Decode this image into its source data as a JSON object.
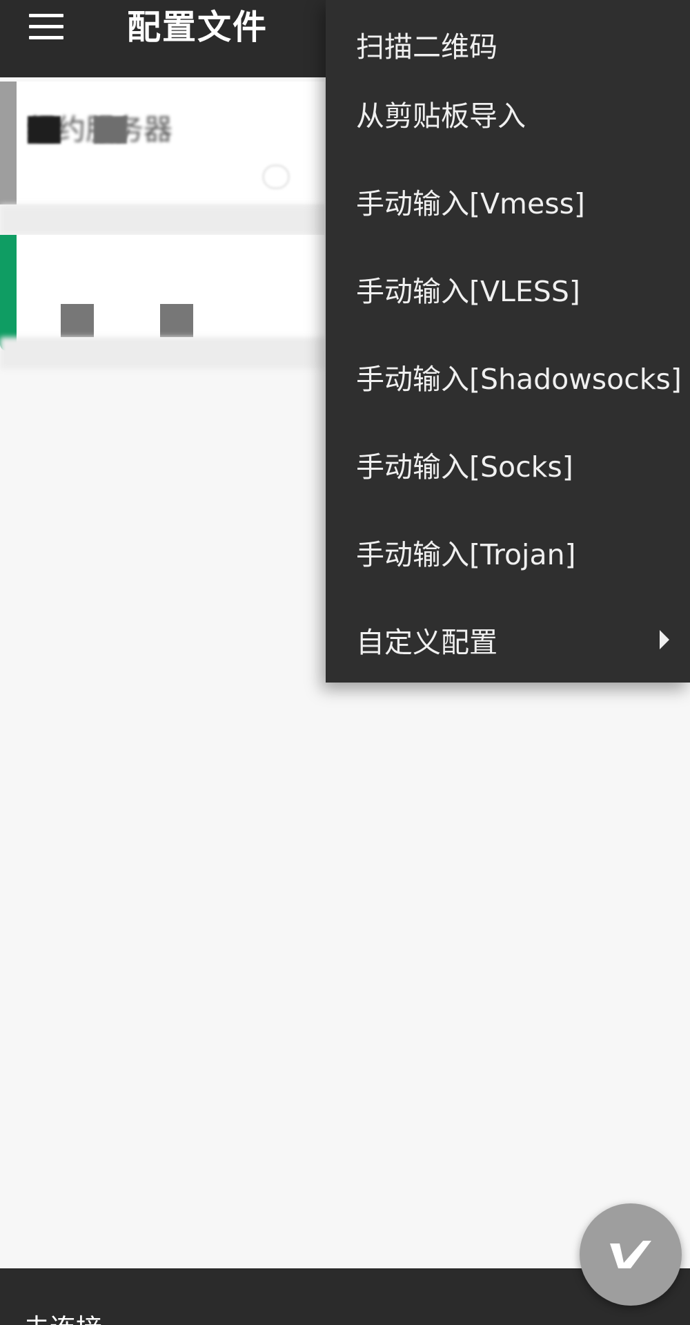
{
  "app_bar": {
    "title": "配置文件",
    "menu_icon": "hamburger-menu-icon"
  },
  "profile_list": {
    "items": [
      {
        "name": "纽约服务器",
        "stripe_color": "#9e9e9e"
      },
      {
        "name": "",
        "stripe_color": "#0f9d63"
      }
    ]
  },
  "overflow_menu": {
    "items": [
      {
        "label": "扫描二维码",
        "has_submenu": false
      },
      {
        "label": "从剪贴板导入",
        "has_submenu": false
      },
      {
        "label": "手动输入[Vmess]",
        "has_submenu": false
      },
      {
        "label": "手动输入[VLESS]",
        "has_submenu": false
      },
      {
        "label": "手动输入[Shadowsocks]",
        "has_submenu": false
      },
      {
        "label": "手动输入[Socks]",
        "has_submenu": false
      },
      {
        "label": "手动输入[Trojan]",
        "has_submenu": false
      },
      {
        "label": "自定义配置",
        "has_submenu": true,
        "submenu_icon": "chevron-right-icon"
      }
    ]
  },
  "bottom_bar": {
    "status": "未连接"
  },
  "fab": {
    "icon": "v-logo-icon",
    "color": "#9e9e9e"
  },
  "colors": {
    "app_bar": "#2b2b2b",
    "menu_background": "#2f2f2f",
    "background": "#f7f7f7",
    "active_accent": "#0f9d63"
  }
}
